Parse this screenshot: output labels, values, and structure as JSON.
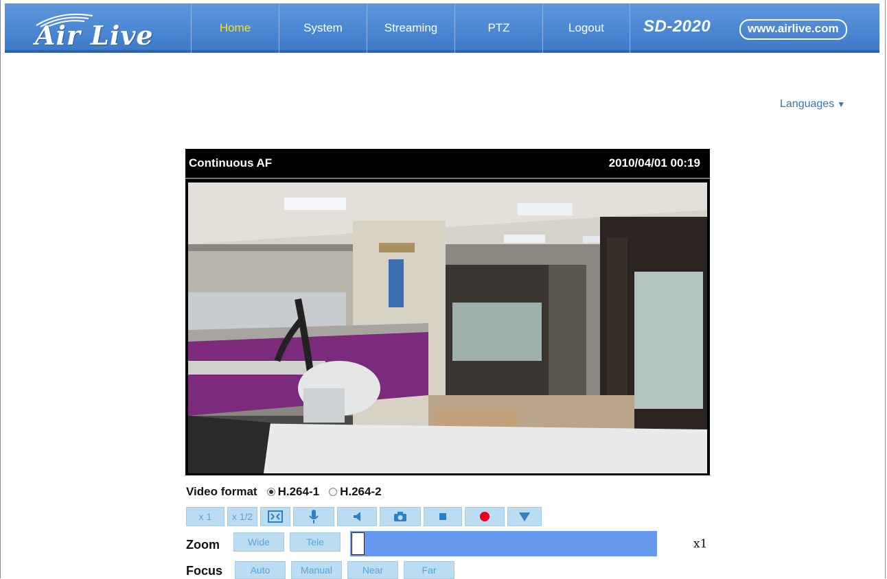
{
  "brand": {
    "logo_text": "Air Live",
    "model": "SD-2020",
    "url": "www.airlive.com"
  },
  "nav": {
    "items": [
      {
        "label": "Home",
        "active": true
      },
      {
        "label": "System"
      },
      {
        "label": "Streaming"
      },
      {
        "label": "PTZ"
      },
      {
        "label": "Logout"
      }
    ]
  },
  "languages": {
    "label": "Languages"
  },
  "video": {
    "mode": "Continuous AF",
    "timestamp": "2010/04/01 00:19"
  },
  "video_format": {
    "label": "Video format",
    "option1": "H.264-1",
    "option2": "H.264-2",
    "selected": "H.264-1"
  },
  "toolbar": {
    "x1": "x 1",
    "x_half": "x 1/2",
    "icons": [
      "fullscreen-icon",
      "microphone-icon",
      "speaker-icon",
      "camera-icon",
      "stop-icon",
      "record-icon",
      "triangle-down-icon"
    ]
  },
  "zoom": {
    "label": "Zoom",
    "wide": "Wide",
    "tele": "Tele",
    "level": 0,
    "value": "x1"
  },
  "focus": {
    "label": "Focus",
    "auto": "Auto",
    "manual": "Manual",
    "near": "Near",
    "far": "Far"
  },
  "colors": {
    "header": "#4a86d2",
    "active_nav": "#ffe100",
    "zoom_bar": "#6699ee",
    "button_bg": "#bcdcf2",
    "button_text": "#5aa3d8",
    "record": "#e8001a"
  }
}
